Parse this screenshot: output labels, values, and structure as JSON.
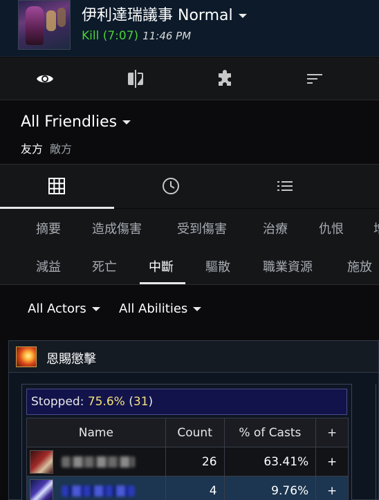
{
  "header": {
    "fight_title": "伊利達瑞議事 Normal",
    "kill_label": "Kill (7:07)",
    "time": "11:46 PM"
  },
  "top_tabs": [
    {
      "icon": "eye-icon",
      "active": true
    },
    {
      "icon": "compare-icon",
      "active": false
    },
    {
      "icon": "puzzle-icon",
      "active": false
    },
    {
      "icon": "sort-icon",
      "active": false
    }
  ],
  "friendlies": {
    "title": "All Friendlies",
    "sub_tabs": [
      "友方",
      "敵方"
    ]
  },
  "view_tabs": [
    {
      "icon": "grid-icon",
      "active": true
    },
    {
      "icon": "clock-icon",
      "active": false
    },
    {
      "icon": "list-icon",
      "active": false
    }
  ],
  "categories": {
    "row1": [
      "摘要",
      "造成傷害",
      "受到傷害",
      "治療",
      "仇恨",
      "增"
    ],
    "row2": [
      "減益",
      "死亡",
      "中斷",
      "驅散",
      "職業資源",
      "施放"
    ],
    "active": "中斷"
  },
  "filters": {
    "actors": "All Actors",
    "abilities": "All Abilities"
  },
  "panel": {
    "spell_name": "恩賜懲擊",
    "stopped_label": "Stopped: ",
    "stopped_pct": "75.6%",
    "stopped_count": "31",
    "columns": [
      "Name",
      "Count",
      "% of Casts",
      "+"
    ],
    "rows": [
      {
        "count": "26",
        "pct": "63.41%",
        "plus": "+"
      },
      {
        "count": "4",
        "pct": "9.76%",
        "plus": "+"
      }
    ]
  },
  "colors": {
    "kill_green": "#4cd137",
    "stopped_value": "#f5e17a",
    "stopped_bg": "#12134a",
    "selected_row": "#1c3550"
  }
}
